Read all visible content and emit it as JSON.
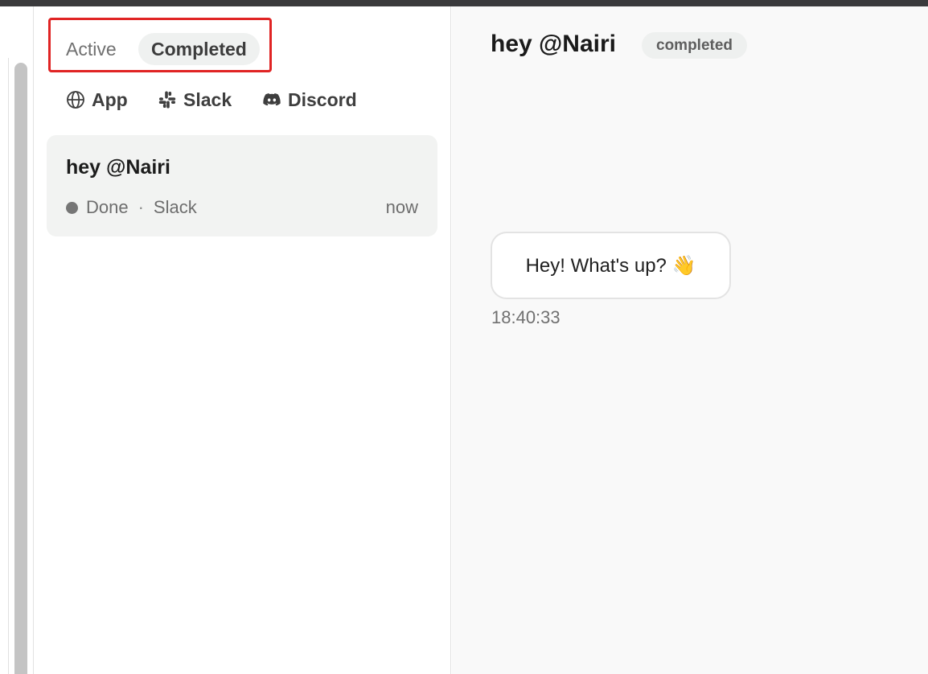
{
  "tabs": [
    {
      "label": "Active",
      "selected": false
    },
    {
      "label": "Completed",
      "selected": true
    }
  ],
  "filters": [
    {
      "label": "App",
      "icon": "globe-icon"
    },
    {
      "label": "Slack",
      "icon": "slack-icon"
    },
    {
      "label": "Discord",
      "icon": "discord-icon"
    }
  ],
  "threads": [
    {
      "title": "hey @Nairi",
      "status": "Done",
      "separator": "·",
      "source": "Slack",
      "time": "now"
    }
  ],
  "detail": {
    "title": "hey @Nairi",
    "status": "completed",
    "messages": [
      {
        "text": "Hey! What's up? 👋",
        "time": "18:40:33"
      }
    ]
  },
  "colors": {
    "highlight_border": "#e02424",
    "selected_tab_bg": "#eff1f0",
    "card_bg": "#f2f3f2",
    "detail_bg": "#f9f9f9",
    "status_dot": "#767676"
  }
}
